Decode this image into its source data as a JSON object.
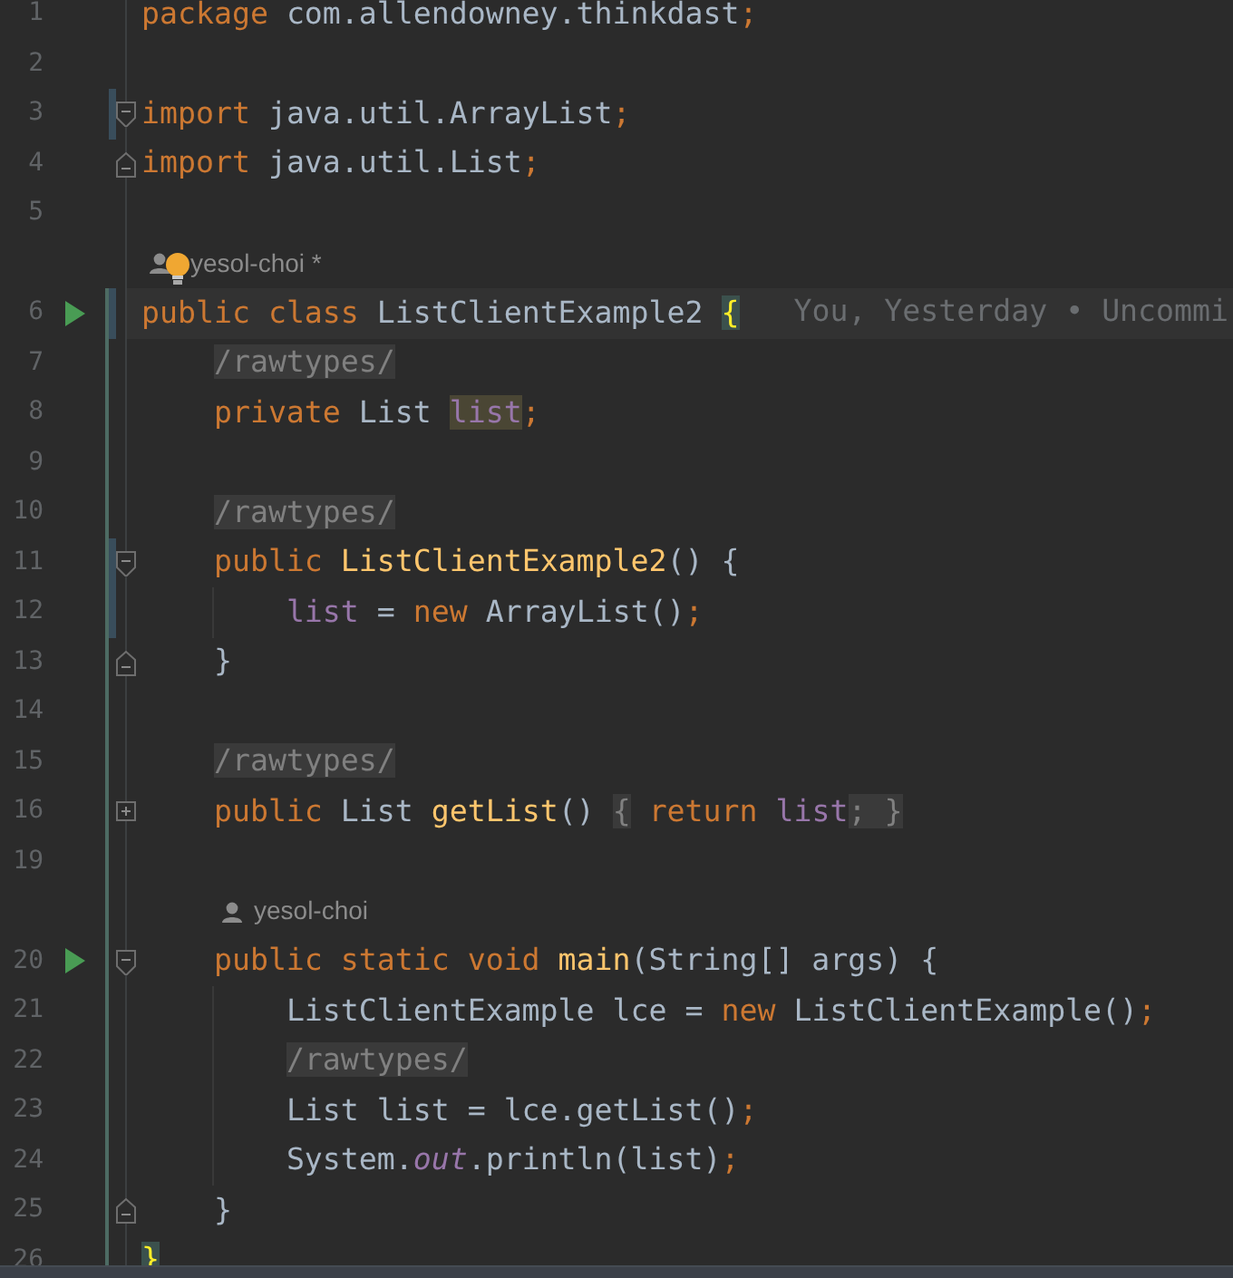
{
  "editor": {
    "lines": [
      {
        "kind": "code",
        "number": "1",
        "tokens": [
          {
            "text": "package",
            "kind": "kw"
          },
          {
            "text": " com.allendowney.thinkdast",
            "kind": "plain"
          },
          {
            "text": ";",
            "kind": "semi"
          }
        ]
      },
      {
        "kind": "code",
        "number": "2"
      },
      {
        "kind": "code",
        "number": "3",
        "change": true,
        "fold_start": true,
        "tokens": [
          {
            "text": "import",
            "kind": "kw"
          },
          {
            "text": " java.util.ArrayList",
            "kind": "plain"
          },
          {
            "text": ";",
            "kind": "semi"
          }
        ]
      },
      {
        "kind": "code",
        "number": "4",
        "fold_end": true,
        "tokens": [
          {
            "text": "import",
            "kind": "kw"
          },
          {
            "text": " java.util.List",
            "kind": "plain"
          },
          {
            "text": ";",
            "kind": "semi"
          }
        ]
      },
      {
        "kind": "code",
        "number": "5"
      },
      {
        "kind": "author",
        "text": "yesol-choi *",
        "bulb": true
      },
      {
        "kind": "code",
        "number": "6",
        "run": true,
        "change": true,
        "current": true,
        "scope": true,
        "tokens": [
          {
            "text": "public",
            "kind": "kw"
          },
          {
            "text": " class",
            "kind": "kw"
          },
          {
            "text": " ListClientExample2",
            "kind": "plain"
          },
          {
            "text": " {",
            "kind": "brace"
          }
        ],
        "blame": "You, Yesterday • Uncommi"
      },
      {
        "kind": "code",
        "number": "7",
        "scope": true,
        "tokens": [
          {
            "text": "    /rawtypes/",
            "kind": "comment"
          }
        ]
      },
      {
        "kind": "code",
        "number": "8",
        "scope": true,
        "tokens": [
          {
            "text": "    private",
            "kind": "kw"
          },
          {
            "text": " List",
            "kind": "plain"
          },
          {
            "text": " list",
            "kind": "usage"
          },
          {
            "text": ";",
            "kind": "semi"
          }
        ]
      },
      {
        "kind": "code",
        "number": "9",
        "scope": true
      },
      {
        "kind": "code",
        "number": "10",
        "scope": true,
        "tokens": [
          {
            "text": "    /rawtypes/",
            "kind": "comment"
          }
        ]
      },
      {
        "kind": "code",
        "number": "11",
        "scope": true,
        "change": true,
        "fold_start": true,
        "tokens": [
          {
            "text": "    public",
            "kind": "kw"
          },
          {
            "text": " ListClientExample2",
            "kind": "decl"
          },
          {
            "text": "() {",
            "kind": "plain"
          }
        ]
      },
      {
        "kind": "code",
        "number": "12",
        "scope": true,
        "change": true,
        "tokens": [
          {
            "text": "        list",
            "kind": "field"
          },
          {
            "text": " =",
            "kind": "plain"
          },
          {
            "text": " new",
            "kind": "kw"
          },
          {
            "text": " ArrayList()",
            "kind": "plain"
          },
          {
            "text": ";",
            "kind": "semi"
          }
        ]
      },
      {
        "kind": "code",
        "number": "13",
        "scope": true,
        "fold_end": true,
        "tokens": [
          {
            "text": "    }",
            "kind": "plain"
          }
        ]
      },
      {
        "kind": "code",
        "number": "14",
        "scope": true
      },
      {
        "kind": "code",
        "number": "15",
        "scope": true,
        "tokens": [
          {
            "text": "    /rawtypes/",
            "kind": "comment"
          }
        ]
      },
      {
        "kind": "code",
        "number": "16",
        "scope": true,
        "collapsed": true,
        "tokens": [
          {
            "text": "    public",
            "kind": "kw"
          },
          {
            "text": " List",
            "kind": "plain"
          },
          {
            "text": " getList",
            "kind": "decl"
          },
          {
            "text": "()",
            "kind": "plain"
          },
          {
            "text": " {",
            "kind": "folded"
          },
          {
            "text": " return",
            "kind": "kw"
          },
          {
            "text": " list",
            "kind": "field"
          },
          {
            "text": "; }",
            "kind": "folded"
          }
        ]
      },
      {
        "kind": "code",
        "number": "19",
        "scope": true
      },
      {
        "kind": "author",
        "text": "yesol-choi",
        "bulb": false,
        "scope": true
      },
      {
        "kind": "code",
        "number": "20",
        "scope": true,
        "run": true,
        "fold_start": true,
        "tokens": [
          {
            "text": "    public static void",
            "kind": "kw"
          },
          {
            "text": " main",
            "kind": "decl"
          },
          {
            "text": "(String[] args) {",
            "kind": "plain"
          }
        ]
      },
      {
        "kind": "code",
        "number": "21",
        "scope": true,
        "tokens": [
          {
            "text": "        ListClientExample lce =",
            "kind": "plain"
          },
          {
            "text": " new",
            "kind": "kw"
          },
          {
            "text": " ListClientExample()",
            "kind": "plain"
          },
          {
            "text": ";",
            "kind": "semi"
          }
        ]
      },
      {
        "kind": "code",
        "number": "22",
        "scope": true,
        "tokens": [
          {
            "text": "        /rawtypes/",
            "kind": "comment"
          }
        ]
      },
      {
        "kind": "code",
        "number": "23",
        "scope": true,
        "tokens": [
          {
            "text": "        List list = lce.getList()",
            "kind": "plain"
          },
          {
            "text": ";",
            "kind": "semi"
          }
        ]
      },
      {
        "kind": "code",
        "number": "24",
        "scope": true,
        "tokens": [
          {
            "text": "        System.",
            "kind": "plain"
          },
          {
            "text": "out",
            "kind": "static"
          },
          {
            "text": ".println(list)",
            "kind": "plain"
          },
          {
            "text": ";",
            "kind": "semi"
          }
        ]
      },
      {
        "kind": "code",
        "number": "25",
        "scope": true,
        "fold_end": true,
        "tokens": [
          {
            "text": "    }",
            "kind": "plain"
          }
        ]
      },
      {
        "kind": "code",
        "number": "26",
        "scope": true,
        "tokens": [
          {
            "text": "}",
            "kind": "brace"
          }
        ]
      }
    ]
  }
}
